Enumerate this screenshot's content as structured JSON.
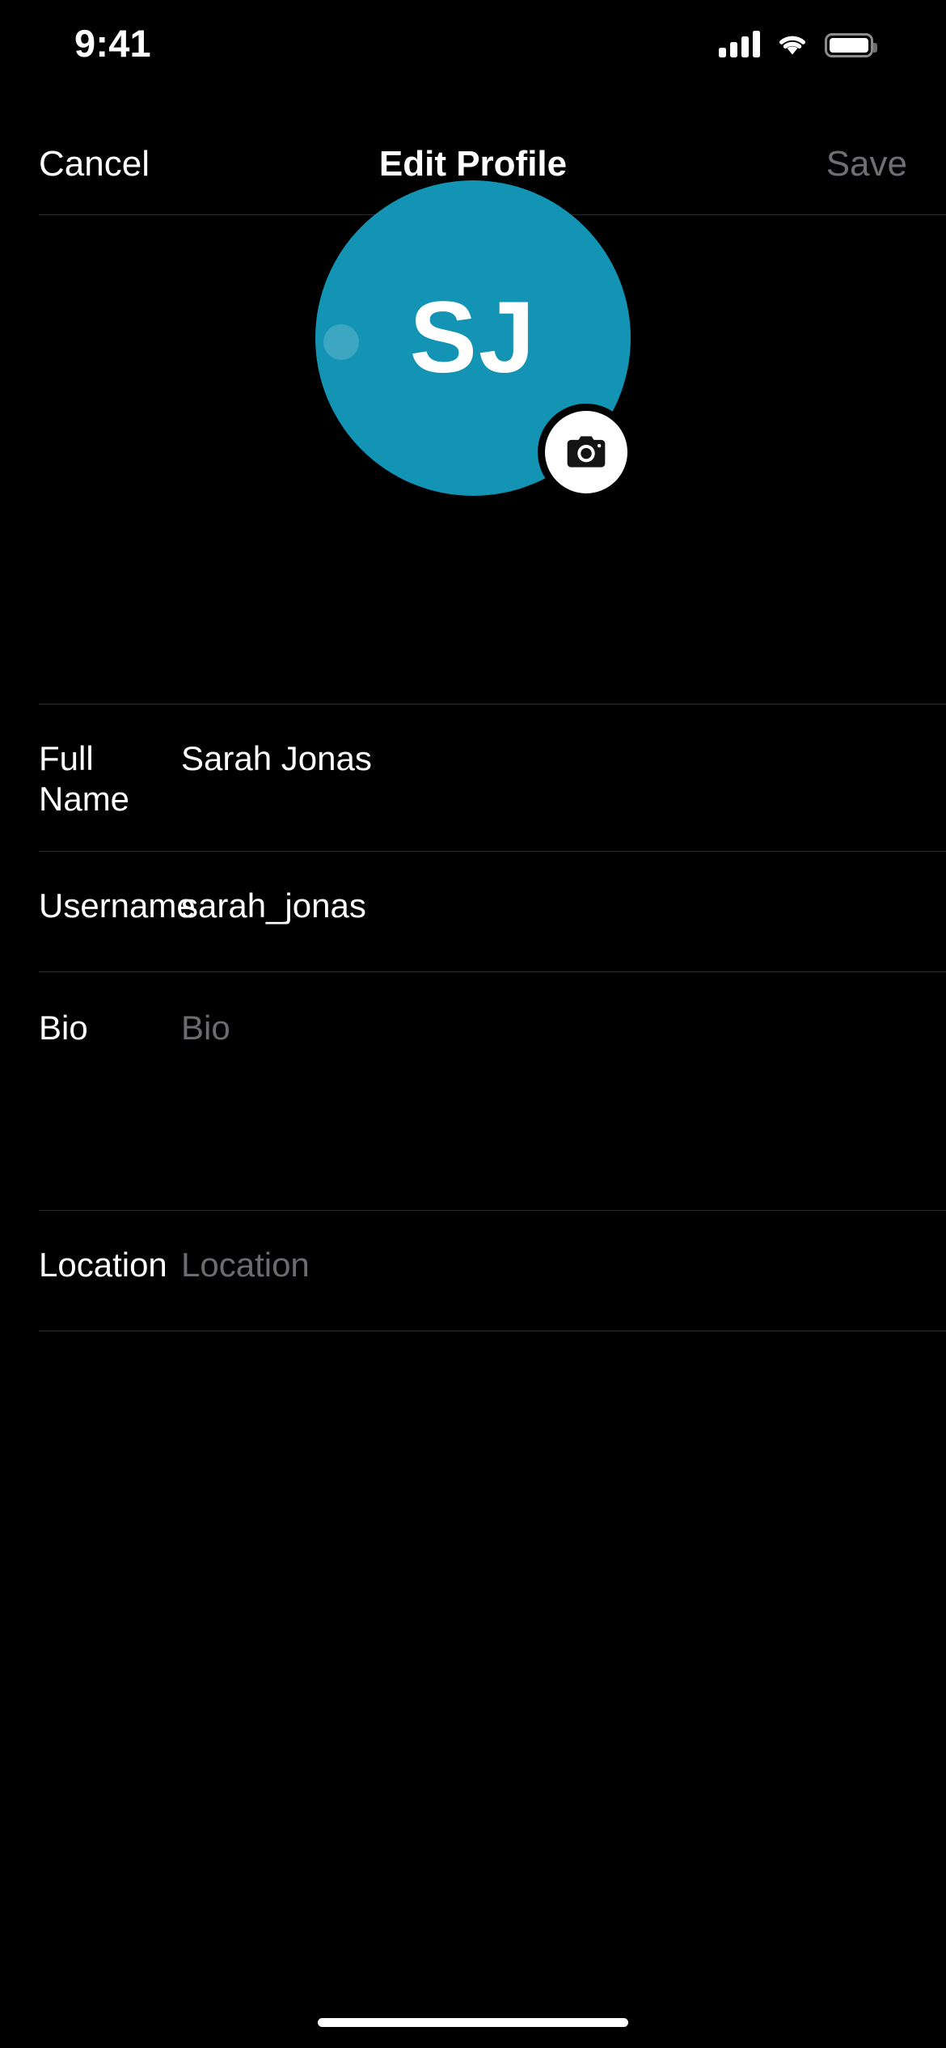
{
  "status_bar": {
    "time": "9:41",
    "cellular_icon": "signal-bars-icon",
    "wifi_icon": "wifi-icon",
    "battery_icon": "battery-icon"
  },
  "nav_bar": {
    "cancel_label": "Cancel",
    "title": "Edit Profile",
    "save_label": "Save",
    "save_enabled": false
  },
  "avatar": {
    "initials": "SJ",
    "background_color": "#1394B5",
    "camera_icon": "camera-icon",
    "camera_button_background": "#FFFFFF"
  },
  "form": {
    "fields": [
      {
        "label": "Full Name",
        "value": "Sarah Jonas",
        "placeholder": "Full Name",
        "is_placeholder": false,
        "multiline": false
      },
      {
        "label": "Username",
        "value": "sarah_jonas",
        "placeholder": "Username",
        "is_placeholder": false,
        "multiline": false
      },
      {
        "label": "Bio",
        "value": "Bio",
        "placeholder": "Bio",
        "is_placeholder": true,
        "multiline": true
      },
      {
        "label": "Location",
        "value": "Location",
        "placeholder": "Location",
        "is_placeholder": true,
        "multiline": false
      }
    ]
  },
  "home_indicator": {
    "color": "#FFFFFF"
  },
  "theme": {
    "background": "#000000",
    "text_primary": "#FFFFFF",
    "text_secondary": "#6E6E73",
    "separator": "#2B2B2D",
    "accent": "#1394B5"
  }
}
